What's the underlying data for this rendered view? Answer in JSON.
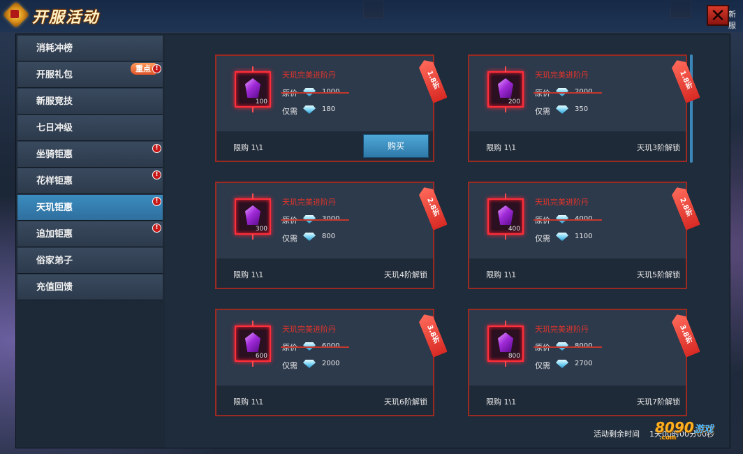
{
  "header": {
    "title": "开服活动",
    "corner_text": "新服"
  },
  "sidebar": {
    "items": [
      {
        "label": "消耗冲榜"
      },
      {
        "label": "开服礼包",
        "tag": "重点"
      },
      {
        "label": "新服竞技"
      },
      {
        "label": "七日冲级"
      },
      {
        "label": "坐骑钜惠"
      },
      {
        "label": "花样钜惠"
      },
      {
        "label": "天玑钜惠",
        "active": true
      },
      {
        "label": "追加钜惠"
      },
      {
        "label": "俗家弟子"
      },
      {
        "label": "充值回馈"
      }
    ],
    "badge_symbol": "!"
  },
  "cards": [
    {
      "discount": "1.8折",
      "name": "天玑完美进阶丹",
      "quantity": "100",
      "original_label": "原价",
      "original_price": "1000",
      "now_label": "仅需",
      "now_price": "180",
      "limit": "限购  1\\1",
      "action": "购买"
    },
    {
      "discount": "1.8折",
      "name": "天玑完美进阶丹",
      "quantity": "200",
      "original_label": "原价",
      "original_price": "2000",
      "now_label": "仅需",
      "now_price": "350",
      "limit": "限购  1\\1",
      "unlock": "天玑3阶解锁"
    },
    {
      "discount": "2.8折",
      "name": "天玑完美进阶丹",
      "quantity": "300",
      "original_label": "原价",
      "original_price": "3000",
      "now_label": "仅需",
      "now_price": "800",
      "limit": "限购  1\\1",
      "unlock": "天玑4阶解锁"
    },
    {
      "discount": "2.8折",
      "name": "天玑完美进阶丹",
      "quantity": "400",
      "original_label": "原价",
      "original_price": "4000",
      "now_label": "仅需",
      "now_price": "1100",
      "limit": "限购  1\\1",
      "unlock": "天玑5阶解锁"
    },
    {
      "discount": "3.8折",
      "name": "天玑完美进阶丹",
      "quantity": "600",
      "original_label": "原价",
      "original_price": "6000",
      "now_label": "仅需",
      "now_price": "2000",
      "limit": "限购  1\\1",
      "unlock": "天玑6阶解锁"
    },
    {
      "discount": "3.8折",
      "name": "天玑完美进阶丹",
      "quantity": "800",
      "original_label": "原价",
      "original_price": "8000",
      "now_label": "仅需",
      "now_price": "2700",
      "limit": "限购  1\\1",
      "unlock": "天玑7阶解锁"
    }
  ],
  "footer": {
    "timer_label": "活动剩余时间",
    "timer_value": "1天00时00分00秒",
    "watermark_main": "8090",
    "watermark_sub": "游戏",
    "watermark_domain": ".com"
  },
  "colors": {
    "accent": "#3a8cbf",
    "card_border": "#9b2a22",
    "item_name": "#e2342a"
  }
}
